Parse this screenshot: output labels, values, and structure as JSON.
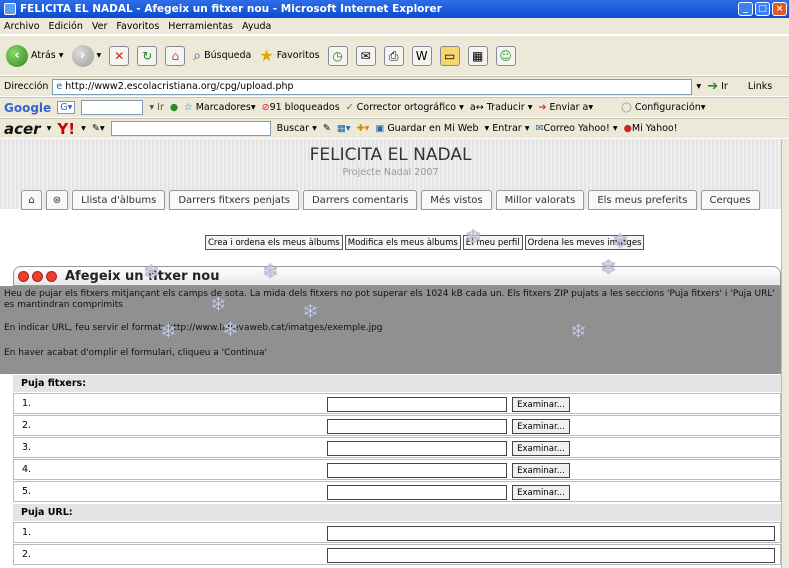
{
  "window": {
    "title": "FELICITA EL NADAL - Afegeix un fitxer nou - Microsoft Internet Explorer"
  },
  "menu": [
    "Archivo",
    "Edición",
    "Ver",
    "Favoritos",
    "Herramientas",
    "Ayuda"
  ],
  "toolbar": {
    "back": "Atrás",
    "search": "Búsqueda",
    "favorites": "Favoritos"
  },
  "address": {
    "label": "Dirección",
    "url": "http://www2.escolacristiana.org/cpg/upload.php",
    "go": "Ir",
    "links": "Links"
  },
  "google_bar": {
    "logo": "Google",
    "g": "G",
    "go": "Ir",
    "bookmarks": "Marcadores",
    "blocked": "91 bloqueados",
    "spell": "Corrector ortográfico",
    "translate": "Traducir",
    "send": "Enviar a",
    "settings": "Configuración"
  },
  "acer_bar": {
    "logo": "acer",
    "yahoo": "Y!",
    "search": "Buscar",
    "save": "Guardar en Mi Web",
    "enter": "Entrar",
    "mail": "Correo Yahoo!",
    "my": "Mi Yahoo!"
  },
  "site": {
    "title": "FELICITA EL NADAL",
    "subtitle": "Projecte Nadal 2007"
  },
  "nav": [
    "Llista d'àlbums",
    "Darrers fitxers penjats",
    "Darrers comentaris",
    "Més vistos",
    "Millor valorats",
    "Els meus preferits",
    "Cerques"
  ],
  "subnav": [
    "Crea i ordena els meus àlbums",
    "Modifica els meus àlbums",
    "El meu perfil",
    "Ordena les meves imatges"
  ],
  "panel": {
    "title": "Afegeix un fitxer nou"
  },
  "info": {
    "p1": "Heu de pujar els fitxers mitjançant els camps de sota. La mida dels fitxers no pot superar els 1024 kB cada un. Els fitxers ZIP pujats a les seccions 'Puja fitxers' i 'Puja URL' es mantindran comprimits",
    "p2": "En indicar URL, feu servir el format: http://www.lanevaweb.cat/imatges/exemple.jpg",
    "p3": "En haver acabat d'omplir el formulari, cliqueu a 'Continua'"
  },
  "upload_files": {
    "heading": "Puja fitxers:",
    "rows": [
      "1.",
      "2.",
      "3.",
      "4.",
      "5."
    ],
    "browse": "Examinar..."
  },
  "upload_url": {
    "heading": "Puja URL:",
    "rows": [
      "1.",
      "2."
    ]
  }
}
